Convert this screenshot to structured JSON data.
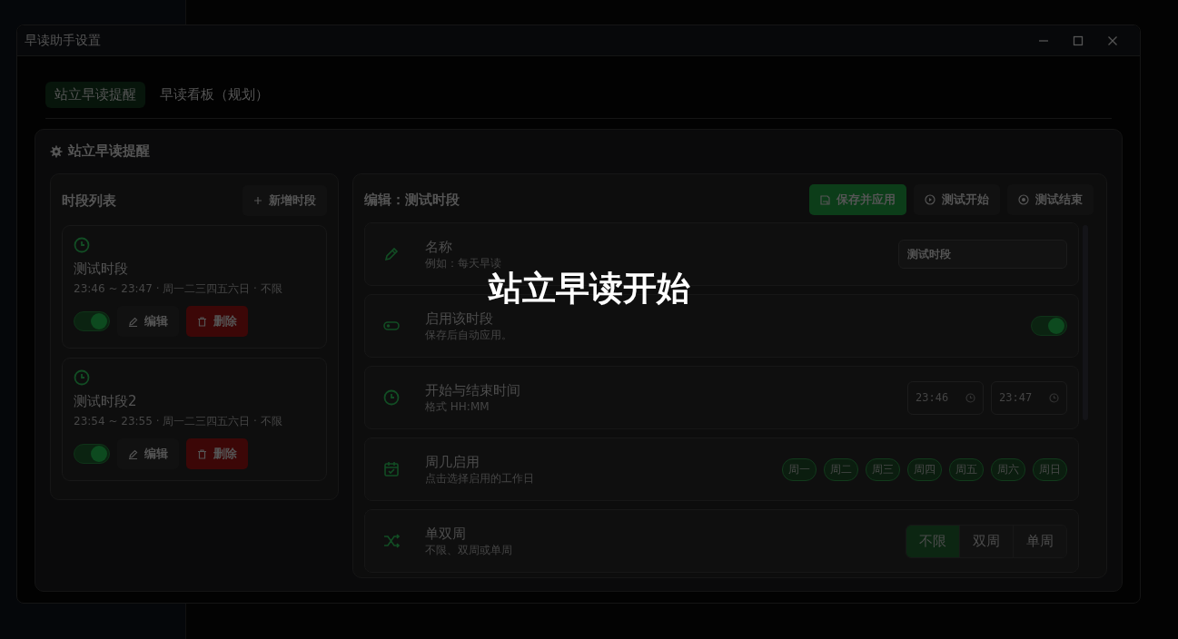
{
  "window": {
    "title": "早读助手设置"
  },
  "tabs": [
    {
      "label": "站立早读提醒",
      "selected": true
    },
    {
      "label": "早读看板（规划）",
      "selected": false
    }
  ],
  "section": {
    "title": "站立早读提醒"
  },
  "periods": {
    "title": "时段列表",
    "add_button": "新增时段",
    "items": [
      {
        "name": "测试时段",
        "summary": "23:46 ~ 23:47 · 周一二三四五六日 · 不限",
        "enabled": true,
        "edit": "编辑",
        "delete": "删除"
      },
      {
        "name": "测试时段2",
        "summary": "23:54 ~ 23:55 · 周一二三四五六日 · 不限",
        "enabled": true,
        "edit": "编辑",
        "delete": "删除"
      }
    ]
  },
  "editor": {
    "title": "编辑：测试时段",
    "actions": [
      {
        "kind": "save",
        "label": "保存并应用"
      },
      {
        "kind": "start",
        "label": "测试开始"
      },
      {
        "kind": "end",
        "label": "测试结束"
      }
    ],
    "fields": [
      {
        "kind": "text",
        "label": "名称",
        "hint": "例如：每天早读",
        "value": "测试时段"
      },
      {
        "kind": "toggle",
        "label": "启用该时段",
        "hint": "保存后自动应用。",
        "on": true
      },
      {
        "kind": "time",
        "label": "开始与结束时间",
        "hint": "格式 HH:MM",
        "values": [
          "23:46",
          "23:47"
        ]
      },
      {
        "kind": "days",
        "label": "周几启用",
        "hint": "点击选择启用的工作日",
        "days": [
          {
            "label": "周一",
            "selected": true
          },
          {
            "label": "周二",
            "selected": true
          },
          {
            "label": "周三",
            "selected": true
          },
          {
            "label": "周四",
            "selected": true
          },
          {
            "label": "周五",
            "selected": true
          },
          {
            "label": "周六",
            "selected": true
          },
          {
            "label": "周日",
            "selected": true
          }
        ]
      },
      {
        "kind": "segment",
        "label": "单双周",
        "hint": "不限、双周或单周",
        "options": [
          {
            "label": "不限",
            "selected": true
          },
          {
            "label": "双周",
            "selected": false
          },
          {
            "label": "单周",
            "selected": false
          }
        ]
      }
    ]
  },
  "overlay": {
    "text": "站立早读开始"
  }
}
